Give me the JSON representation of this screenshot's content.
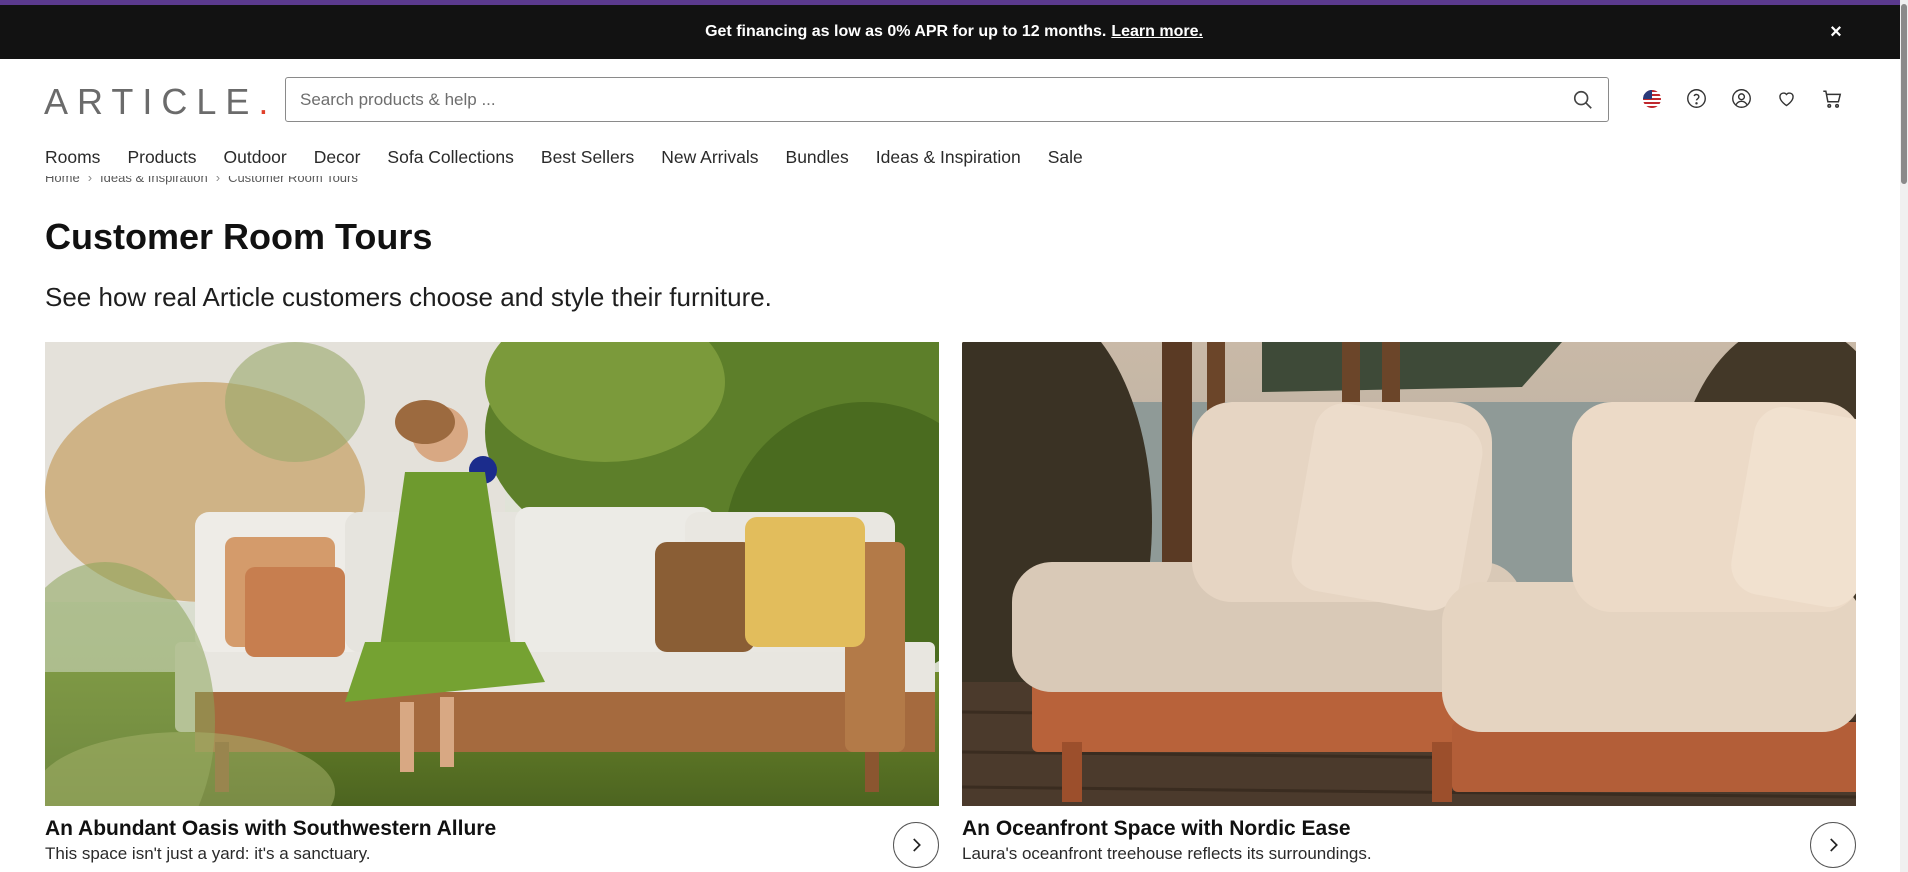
{
  "promo": {
    "text": "Get financing as low as 0% APR for up to 12 months.",
    "link": "Learn more.",
    "close": "×"
  },
  "header": {
    "logo": "ARTICLE",
    "logo_dot": ".",
    "search_placeholder": "Search products & help ...",
    "icons": [
      "us-flag-icon",
      "help-icon",
      "account-icon",
      "heart-icon",
      "cart-icon"
    ]
  },
  "nav": {
    "items": [
      "Rooms",
      "Products",
      "Outdoor",
      "Decor",
      "Sofa Collections",
      "Best Sellers",
      "New Arrivals",
      "Bundles",
      "Ideas & Inspiration",
      "Sale"
    ]
  },
  "breadcrumb": {
    "items": [
      "Home",
      "Ideas & Inspiration",
      "Customer Room Tours"
    ],
    "separator": "›"
  },
  "page": {
    "title": "Customer Room Tours",
    "subtitle": "See how real Article customers choose and style their furniture."
  },
  "cards": [
    {
      "title": "An Abundant Oasis with Southwestern Allure",
      "description": "This space isn't just a yard: it's a sanctuary."
    },
    {
      "title": "An Oceanfront Space with Nordic Ease",
      "description": "Laura's oceanfront treehouse reflects its surroundings."
    }
  ],
  "colors": {
    "promo_bg": "#121212",
    "accent_bar": "#5b3a8e",
    "logo_dot": "#e0402a"
  }
}
